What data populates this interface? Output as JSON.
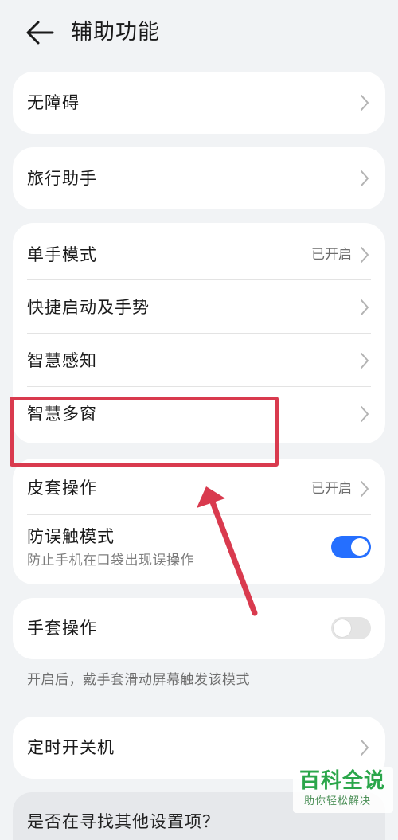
{
  "header": {
    "title": "辅助功能",
    "back_icon": "back-arrow-icon"
  },
  "cards": {
    "accessibility": {
      "label": "无障碍"
    },
    "travel_assistant": {
      "label": "旅行助手"
    },
    "gestures": {
      "one_hand_mode": {
        "label": "单手模式",
        "value": "已开启"
      },
      "shortcut_gestures": {
        "label": "快捷启动及手势"
      },
      "smart_perception": {
        "label": "智慧感知"
      },
      "smart_multi_window": {
        "label": "智慧多窗"
      }
    },
    "cover": {
      "cover_operation": {
        "label": "皮套操作",
        "value": "已开启"
      },
      "accidental_touch": {
        "label": "防误触模式",
        "description": "防止手机在口袋出现误操作",
        "toggle": "on"
      }
    },
    "glove": {
      "label": "手套操作",
      "toggle": "off"
    },
    "glove_note": "开启后，戴手套滑动屏幕触发该模式",
    "scheduled_power": {
      "label": "定时开关机"
    },
    "partial_prompt": "是否在寻找其他设置项？"
  },
  "annotation": {
    "highlight_color": "#d93a4e"
  },
  "watermark": {
    "brand": "百科全说",
    "slogan": "助你轻松解决"
  },
  "colors": {
    "background": "#f1f3f5",
    "card": "#ffffff",
    "toggle_on": "#256fff",
    "toggle_off": "#e4e4e4",
    "watermark_green": "#2aa64a"
  }
}
